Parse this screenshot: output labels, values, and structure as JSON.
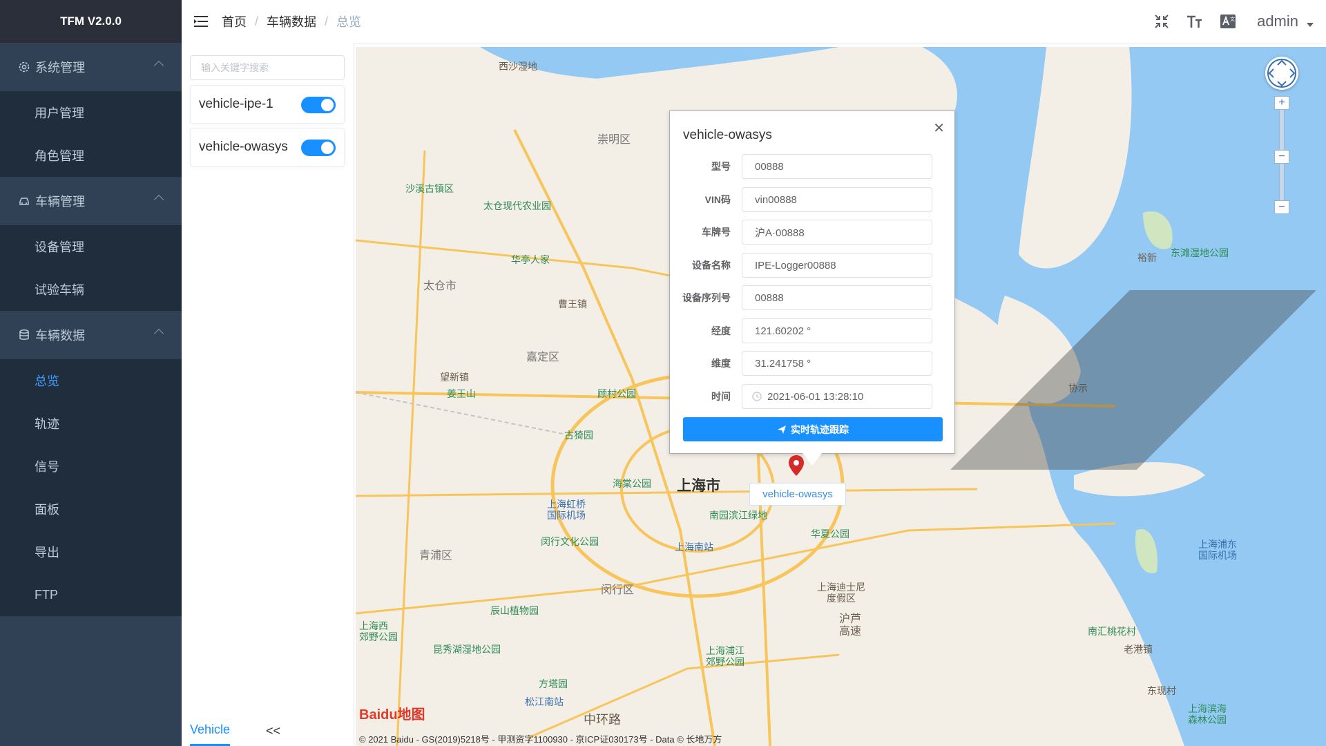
{
  "app": {
    "title": "TFM V2.0.0"
  },
  "sidebar": {
    "groups": [
      {
        "label": "系统管理",
        "icon": "gear-icon",
        "items": [
          "用户管理",
          "角色管理"
        ]
      },
      {
        "label": "车辆管理",
        "icon": "car-icon",
        "items": [
          "设备管理",
          "试验车辆"
        ]
      },
      {
        "label": "车辆数据",
        "icon": "database-icon",
        "items": [
          "总览",
          "轨迹",
          "信号",
          "面板",
          "导出",
          "FTP"
        ],
        "active_item": "总览"
      }
    ]
  },
  "breadcrumb": {
    "items": [
      "首页",
      "车辆数据",
      "总览"
    ]
  },
  "header": {
    "user": "admin"
  },
  "vehicle_panel": {
    "search_placeholder": "输入关键字搜索",
    "vehicles": [
      {
        "name": "vehicle-ipe-1",
        "enabled": true
      },
      {
        "name": "vehicle-owasys",
        "enabled": true
      }
    ],
    "tab_label": "Vehicle",
    "collapse_label": "<<"
  },
  "popup": {
    "title": "vehicle-owasys",
    "close_label": "✕",
    "fields": [
      {
        "label": "型号",
        "value": "00888"
      },
      {
        "label": "VIN码",
        "value": "vin00888"
      },
      {
        "label": "车牌号",
        "value": "沪A·00888"
      },
      {
        "label": "设备名称",
        "value": "IPE-Logger00888"
      },
      {
        "label": "设备序列号",
        "value": "00888"
      },
      {
        "label": "经度",
        "value": "121.60202 °"
      },
      {
        "label": "维度",
        "value": "31.241758 °"
      },
      {
        "label": "时间",
        "value": "2021-06-01 13:28:10"
      }
    ],
    "button_label": "实时轨迹跟踪"
  },
  "map": {
    "vehicle_label": "vehicle-owasys",
    "baidu_logo": "Baidu地图",
    "copyright": "© 2021 Baidu - GS(2019)5218号 - 甲测资字1100930 - 京ICP证030173号 - Data © 长地万方",
    "places": {
      "shanghai": "上海市",
      "chongming": "崇明区",
      "taicang": "太仓市",
      "jiading": "嘉定区",
      "qingpu": "青浦区",
      "minhang": "闵行区",
      "hongqiao": "上海虹桥\n国际机场",
      "pudong_airport": "上海浦东\n国际机场",
      "shanghai_south": "上海南站",
      "disney": "上海迪士尼\n度假区",
      "xisha": "西沙湿地",
      "dongtan": "东滩湿地公园",
      "shaxi": "沙溪古镇区",
      "taicang_park": "太仓现代农业园",
      "huating": "华亭人家",
      "gucun": "顾村公园",
      "gucun_jing": "古猗园",
      "haitang": "海棠公园",
      "nanyuan": "南园滨江绿地",
      "huaxia": "华夏公园",
      "minhang_park": "闵行文化公园",
      "chenshan": "辰山植物园",
      "qingxi": "上海西\n郊野公园",
      "dianshan": "昆秀湖湿地公园",
      "fangta": "方塔园",
      "songjiang": "松江南站",
      "pujiang": "上海浦江\n郊野公园",
      "nanhui": "南汇桃花村",
      "binhai": "上海滨海\n森林公园",
      "hutong": "沪芦\n高速",
      "zhonghuan": "中环路",
      "jingwang": "姜王山",
      "jiangyin": "望新镇",
      "zhoushi": "曹王镇",
      "laogang": "老港镇",
      "dongcun": "东现村",
      "yugu": "裕新",
      "xiexin": "协示"
    }
  }
}
